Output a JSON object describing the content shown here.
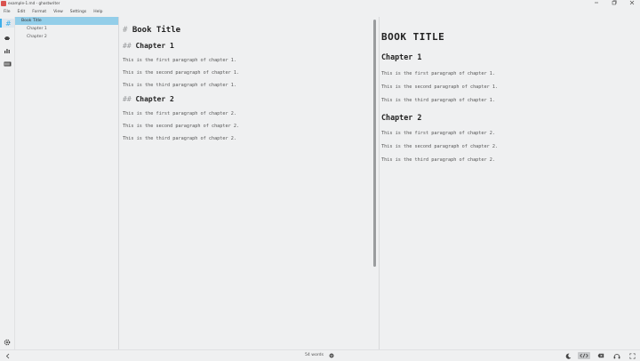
{
  "window": {
    "title": "example-1.md - ghostwriter",
    "minimize_icon": "minimize-icon",
    "maximize_icon": "maximize-icon",
    "close_icon": "close-icon"
  },
  "menu": [
    "File",
    "Edit",
    "Format",
    "View",
    "Settings",
    "Help"
  ],
  "activity_bar": {
    "icons": [
      "outline-icon",
      "session-statistics-icon",
      "document-statistics-icon",
      "cheat-sheet-icon",
      "settings-icon"
    ]
  },
  "outline": {
    "items": [
      {
        "label": "Book Title",
        "level": 1,
        "selected": true
      },
      {
        "label": "Chapter 1",
        "level": 2,
        "selected": false
      },
      {
        "label": "Chapter 2",
        "level": 2,
        "selected": false
      }
    ]
  },
  "editor": {
    "h1_mark": "#",
    "h1_text": "Book Title",
    "h2_mark": "##",
    "chapter1_title": "Chapter 1",
    "chapter1_paragraphs": [
      "This is the first paragraph of chapter 1.",
      "This is the second paragraph of chapter 1.",
      "This is the third paragraph of chapter 1."
    ],
    "chapter2_title": "Chapter 2",
    "chapter2_paragraphs": [
      "This is the first paragraph of chapter 2.",
      "This is the second paragraph of chapter 2.",
      "This is the third paragraph of chapter 2."
    ]
  },
  "preview": {
    "h1_text": "BOOK TITLE",
    "chapter1_title": "Chapter 1",
    "chapter1_paragraphs": [
      "This is the first paragraph of chapter 1.",
      "This is the second paragraph of chapter 1.",
      "This is the third paragraph of chapter 1."
    ],
    "chapter2_title": "Chapter 2",
    "chapter2_paragraphs": [
      "This is the first paragraph of chapter 2.",
      "This is the second paragraph of chapter 2.",
      "This is the third paragraph of chapter 2."
    ]
  },
  "status": {
    "word_count": "54 words",
    "accent": "#3daee9",
    "icons": [
      "toggle-sidebar-icon",
      "word-count-menu-icon",
      "dark-mode-icon",
      "html-preview-icon",
      "hemingway-mode-icon",
      "distraction-free-icon",
      "fullscreen-icon"
    ]
  }
}
